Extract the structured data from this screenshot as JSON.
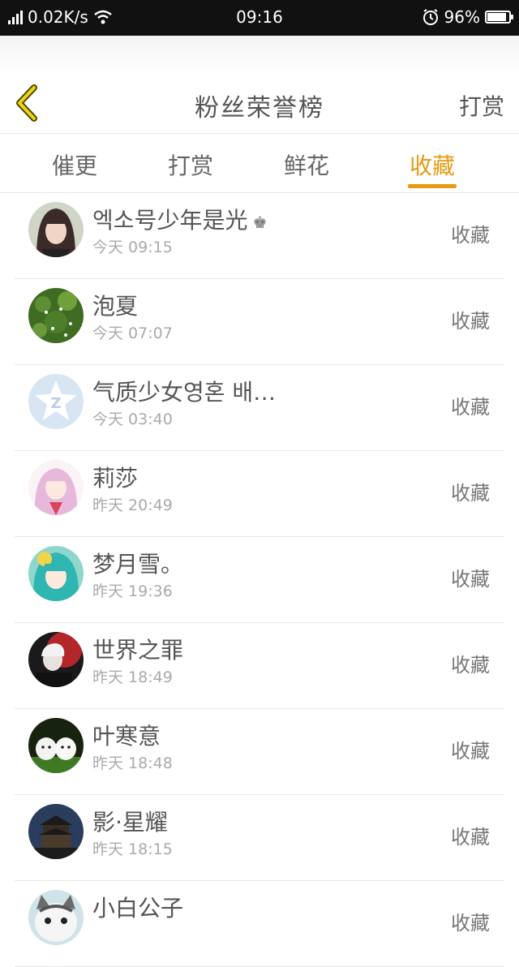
{
  "status_bar": {
    "speed": "0.02K/s",
    "time": "09:16",
    "battery": "96%",
    "battery_level": 0.96
  },
  "header": {
    "title": "粉丝荣誉榜",
    "action": "打赏"
  },
  "tabs": [
    {
      "label": "催更",
      "active": false
    },
    {
      "label": "打赏",
      "active": false
    },
    {
      "label": "鲜花",
      "active": false
    },
    {
      "label": "收藏",
      "active": true
    }
  ],
  "fans": [
    {
      "name": "엑소号少年是光",
      "time": "今天 09:15",
      "action": "收藏",
      "has_crown": true,
      "avatar": "girl-photo"
    },
    {
      "name": "泡夏",
      "time": "今天 07:07",
      "action": "收藏",
      "avatar": "green-flowers"
    },
    {
      "name": "气质少女영혼 배…",
      "time": "今天 03:40",
      "action": "收藏",
      "avatar": "default-star"
    },
    {
      "name": "莉莎",
      "time": "昨天 20:49",
      "action": "收藏",
      "avatar": "anime-pink-hair"
    },
    {
      "name": "梦月雪。",
      "time": "昨天 19:36",
      "action": "收藏",
      "avatar": "anime-teal-hair"
    },
    {
      "name": "世界之罪",
      "time": "昨天 18:49",
      "action": "收藏",
      "avatar": "anime-dark-red"
    },
    {
      "name": "叶寒意",
      "time": "昨天 18:48",
      "action": "收藏",
      "avatar": "white-puppies"
    },
    {
      "name": "影·星耀",
      "time": "昨天 18:15",
      "action": "收藏",
      "avatar": "pagoda-night"
    },
    {
      "name": "小白公子",
      "time": "",
      "action": "收藏",
      "avatar": "cartoon-cat"
    }
  ],
  "colors": {
    "accent": "#e89a12",
    "status_bar": "#111111"
  }
}
